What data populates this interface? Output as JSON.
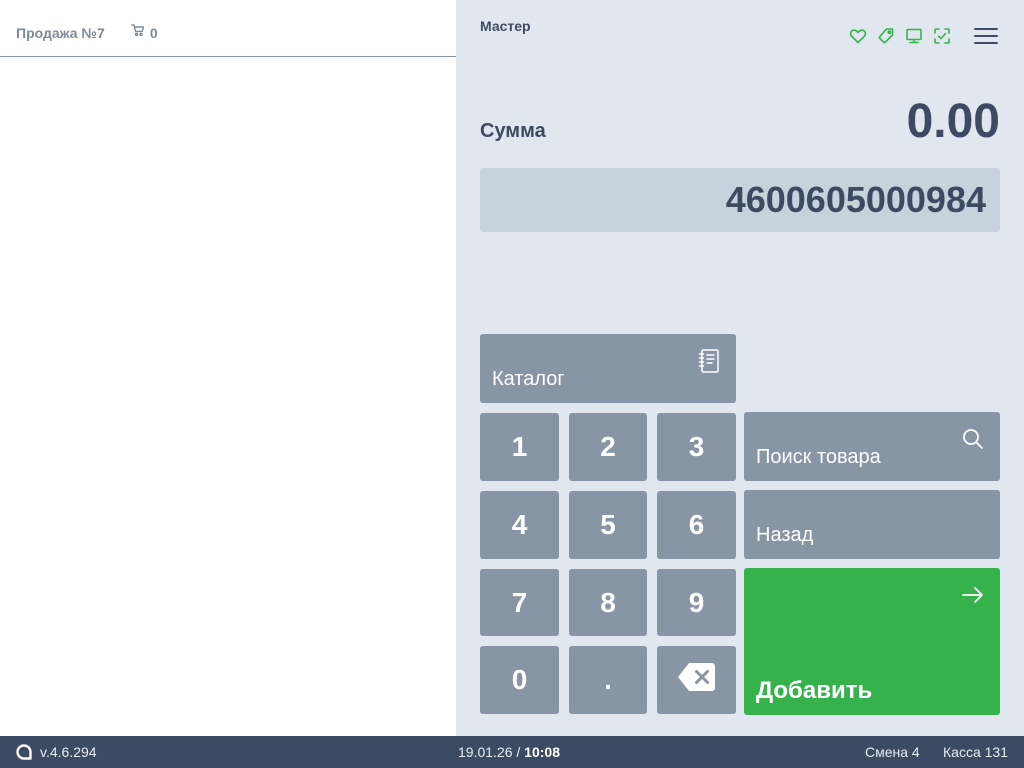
{
  "sale": {
    "title": "Продажа №7",
    "cart_count": "0"
  },
  "cashier": {
    "name": "Мастер"
  },
  "status_icons": [
    "heart-icon",
    "tag-icon",
    "monitor-icon",
    "scan-icon"
  ],
  "sum": {
    "label": "Сумма",
    "value": "0.00"
  },
  "input": {
    "value": "4600605000984"
  },
  "buttons": {
    "catalog": "Каталог",
    "search": "Поиск товара",
    "back": "Назад",
    "add": "Добавить"
  },
  "keypad": {
    "k1": "1",
    "k2": "2",
    "k3": "3",
    "k4": "4",
    "k5": "5",
    "k6": "6",
    "k7": "7",
    "k8": "8",
    "k9": "9",
    "k0": "0",
    "dot": "."
  },
  "footer": {
    "version": "v.4.6.294",
    "date": "19.01.26",
    "separator": "/",
    "time": "10:08",
    "shift": "Смена 4",
    "register": "Касса 131"
  },
  "colors": {
    "accent_green": "#36b24d",
    "key_gray": "#8795a4",
    "panel_bg": "#e1e7ef",
    "input_bg": "#c7d2dd",
    "text_dark": "#3d4a62",
    "footer_bg": "#3c4a62"
  }
}
